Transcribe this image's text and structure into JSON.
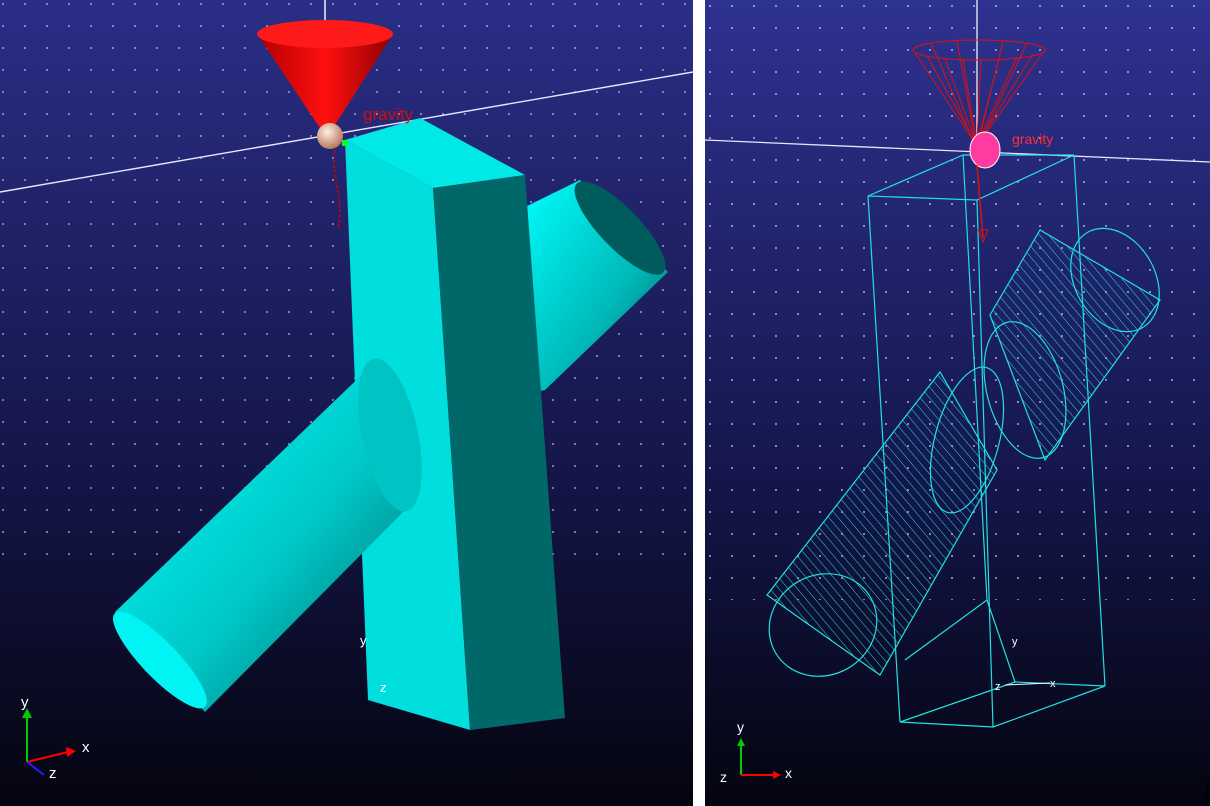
{
  "viewports": [
    {
      "name": "shaded",
      "gravity_label": "gravity",
      "axis": {
        "x": "x",
        "y": "y",
        "z": "z"
      },
      "body_axis": {
        "y": "y",
        "z": "z"
      }
    },
    {
      "name": "wireframe",
      "gravity_label": "gravity",
      "axis": {
        "x": "x",
        "y": "y",
        "z": "z"
      },
      "body_axis": {
        "y": "y",
        "z": "z",
        "x": "x"
      }
    }
  ],
  "colors": {
    "background_top": "#2b2f85",
    "background_bottom": "#05051a",
    "body": "#00e0e0",
    "gravity_cone": "#ff0000",
    "axis_x": "#ff0000",
    "axis_y": "#00cc00",
    "axis_z": "#0000ff",
    "label": "#ffffff"
  }
}
